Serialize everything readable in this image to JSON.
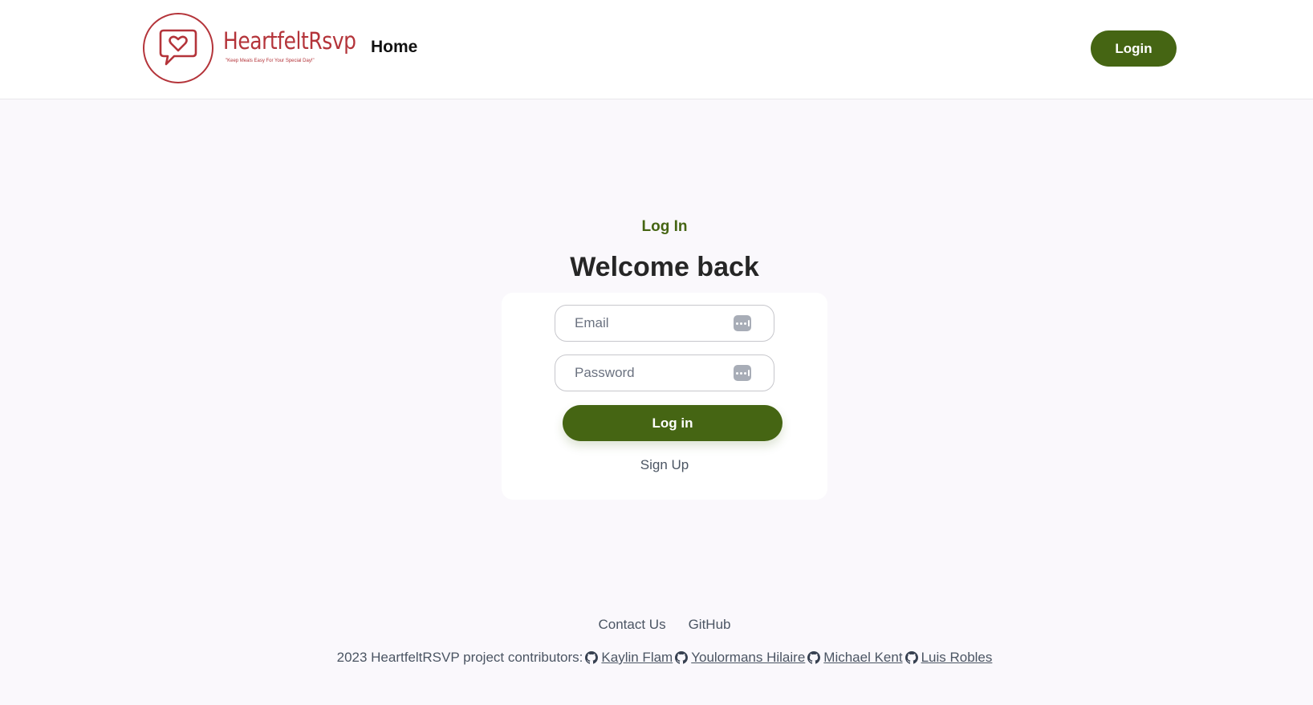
{
  "header": {
    "logo_name": "HeartfeltRsvp",
    "logo_tagline": "\"Keep Meals Easy For Your Special Day!\"",
    "nav_home": "Home",
    "login_button": "Login"
  },
  "main": {
    "eyebrow": "Log In",
    "heading": "Welcome back",
    "email_placeholder": "Email",
    "password_placeholder": "Password",
    "submit_label": "Log in",
    "signup_link": "Sign Up"
  },
  "footer": {
    "links": [
      "Contact Us",
      "GitHub"
    ],
    "credits_prefix": "2023 HeartfeltRSVP project contributors:",
    "contributors": [
      "Kaylin Flam",
      "Youlormans Hilaire",
      "Michael Kent",
      "Luis Robles"
    ]
  },
  "colors": {
    "brand_red": "#b4343a",
    "accent_green": "#456513",
    "background": "#faf8fc"
  }
}
